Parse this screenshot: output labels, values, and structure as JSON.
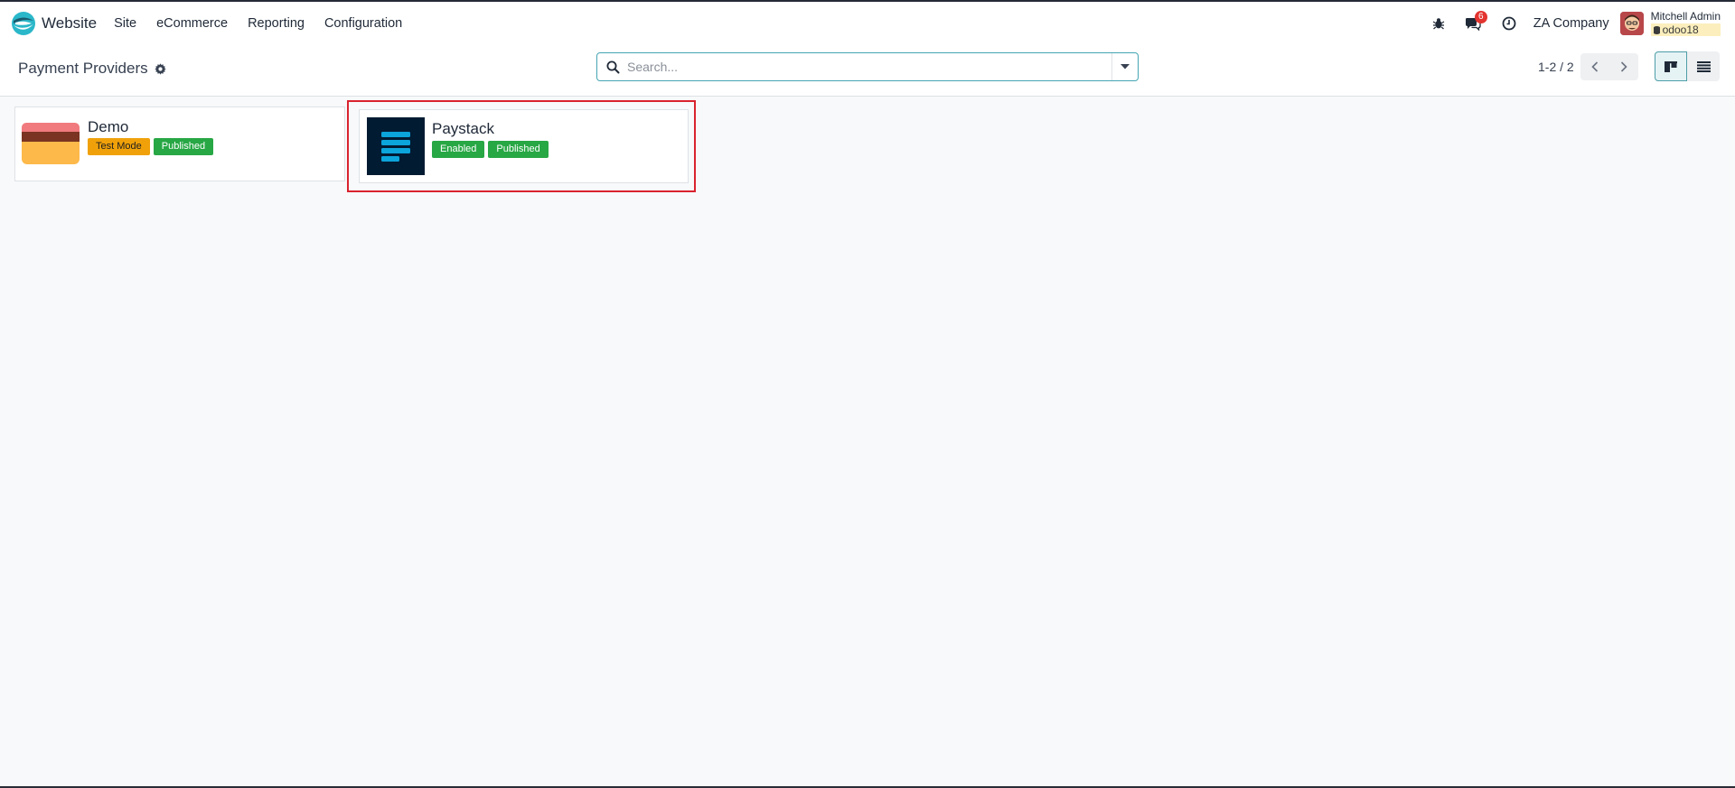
{
  "navbar": {
    "app_name": "Website",
    "menu": [
      "Site",
      "eCommerce",
      "Reporting",
      "Configuration"
    ],
    "message_count": "6",
    "company": "ZA Company",
    "user_name": "Mitchell Admin",
    "database": "odoo18"
  },
  "control_panel": {
    "title": "Payment Providers",
    "search_placeholder": "Search...",
    "pager": "1-2 / 2"
  },
  "cards": [
    {
      "name": "Demo",
      "tags": [
        {
          "label": "Test Mode",
          "style": "warning"
        },
        {
          "label": "Published",
          "style": "success"
        }
      ]
    },
    {
      "name": "Paystack",
      "tags": [
        {
          "label": "Enabled",
          "style": "success"
        },
        {
          "label": "Published",
          "style": "success"
        }
      ],
      "highlighted": true
    }
  ],
  "colors": {
    "accent": "#45a5b3",
    "success": "#28a745",
    "warning": "#f0a10a",
    "highlight": "#d9232e",
    "badge": "#e3342f"
  },
  "icons": [
    "website-logo-icon",
    "bug-icon",
    "chat-icon",
    "clock-icon",
    "gear-icon",
    "search-icon",
    "caret-down-icon",
    "chevron-left-icon",
    "chevron-right-icon",
    "kanban-view-icon",
    "list-view-icon",
    "database-icon"
  ]
}
